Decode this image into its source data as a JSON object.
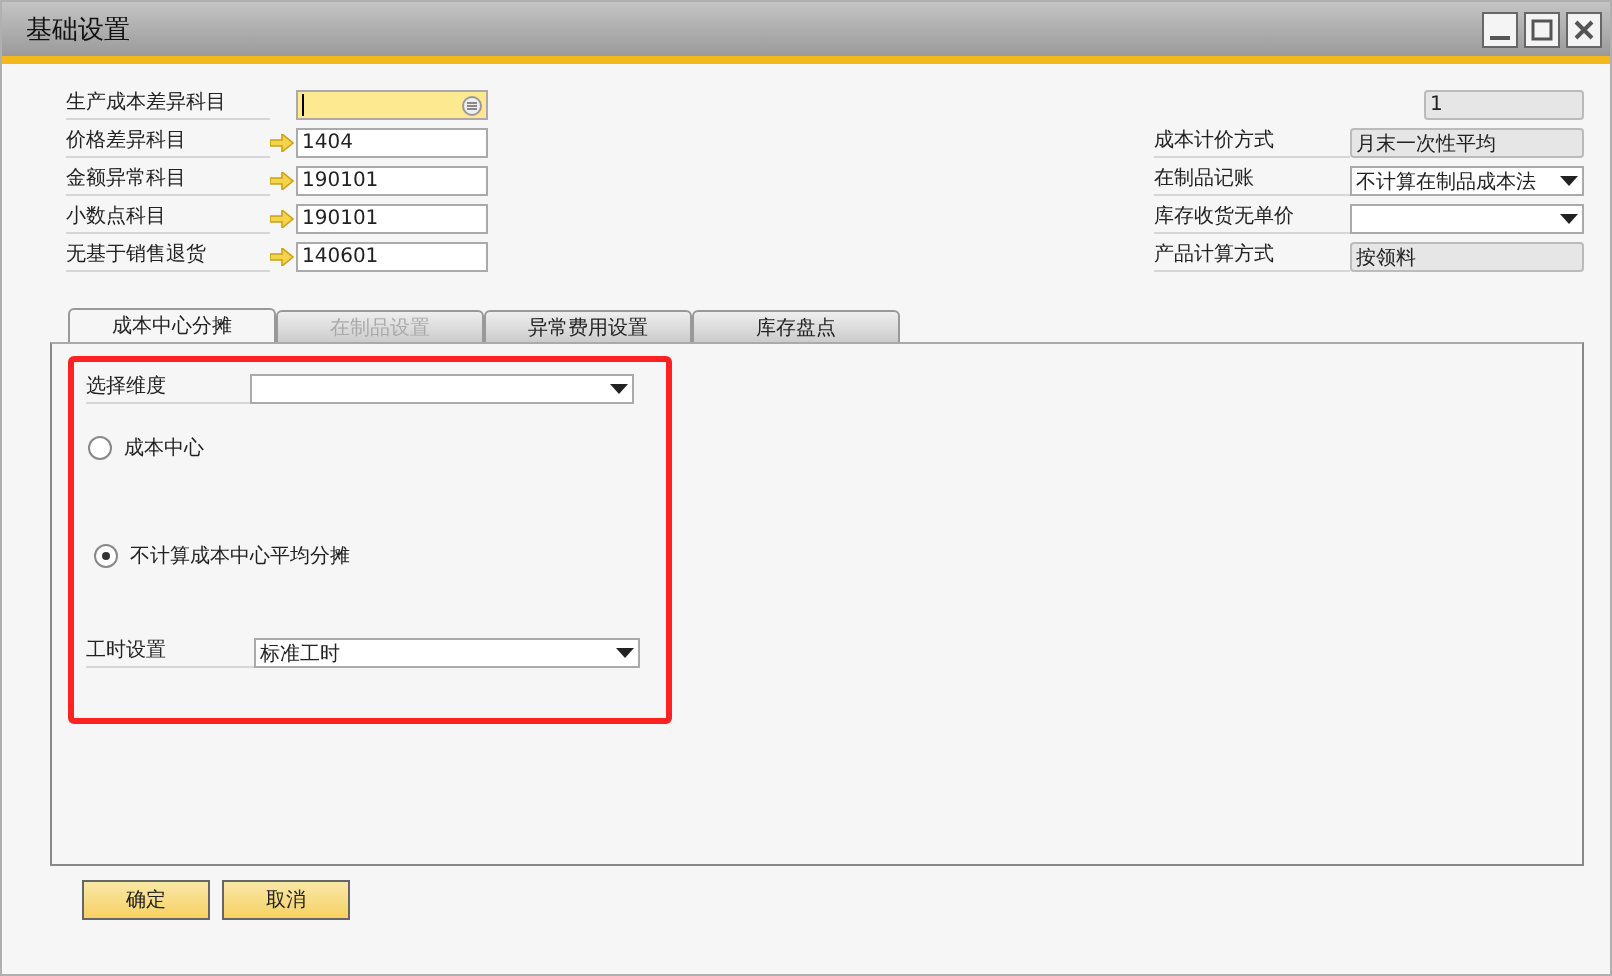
{
  "window": {
    "title": "基础设置"
  },
  "left_fields": [
    {
      "label": "生产成本差异科目",
      "kind": "lookup",
      "focused": true
    },
    {
      "label": "价格差异科目",
      "value": "1404",
      "kind": "linked",
      "focused": false
    },
    {
      "label": "金额异常科目",
      "value": "190101",
      "kind": "linked",
      "focused": false
    },
    {
      "label": "小数点科目",
      "value": "190101",
      "kind": "linked",
      "focused": false
    },
    {
      "label": "无基于销售退货",
      "value": "140601",
      "kind": "linked",
      "focused": false
    }
  ],
  "right_fields": [
    {
      "value": "1",
      "kind": "readonly"
    },
    {
      "label": "成本计价方式",
      "value": "月末一次性平均",
      "kind": "readonly"
    },
    {
      "label": "在制品记账",
      "value": "不计算在制品成本法",
      "kind": "dropdown"
    },
    {
      "label": "库存收货无单价",
      "kind": "dropdown"
    },
    {
      "label": "产品计算方式",
      "value": "按领料",
      "kind": "readonly"
    }
  ],
  "tabs": [
    {
      "label": "成本中心分摊",
      "selected": true,
      "disabled": false
    },
    {
      "label": "在制品设置",
      "selected": false,
      "disabled": true
    },
    {
      "label": "异常费用设置",
      "selected": false,
      "disabled": false
    },
    {
      "label": "库存盘点",
      "selected": false,
      "disabled": false
    }
  ],
  "panel": {
    "dimension": {
      "label": "选择维度"
    },
    "radios": [
      {
        "label": "成本中心",
        "selected": false
      },
      {
        "label": "不计算成本中心平均分摊",
        "selected": true
      }
    ],
    "hours": {
      "label": "工时设置",
      "value": "标准工时"
    }
  },
  "buttons": [
    "确定",
    "取消"
  ]
}
